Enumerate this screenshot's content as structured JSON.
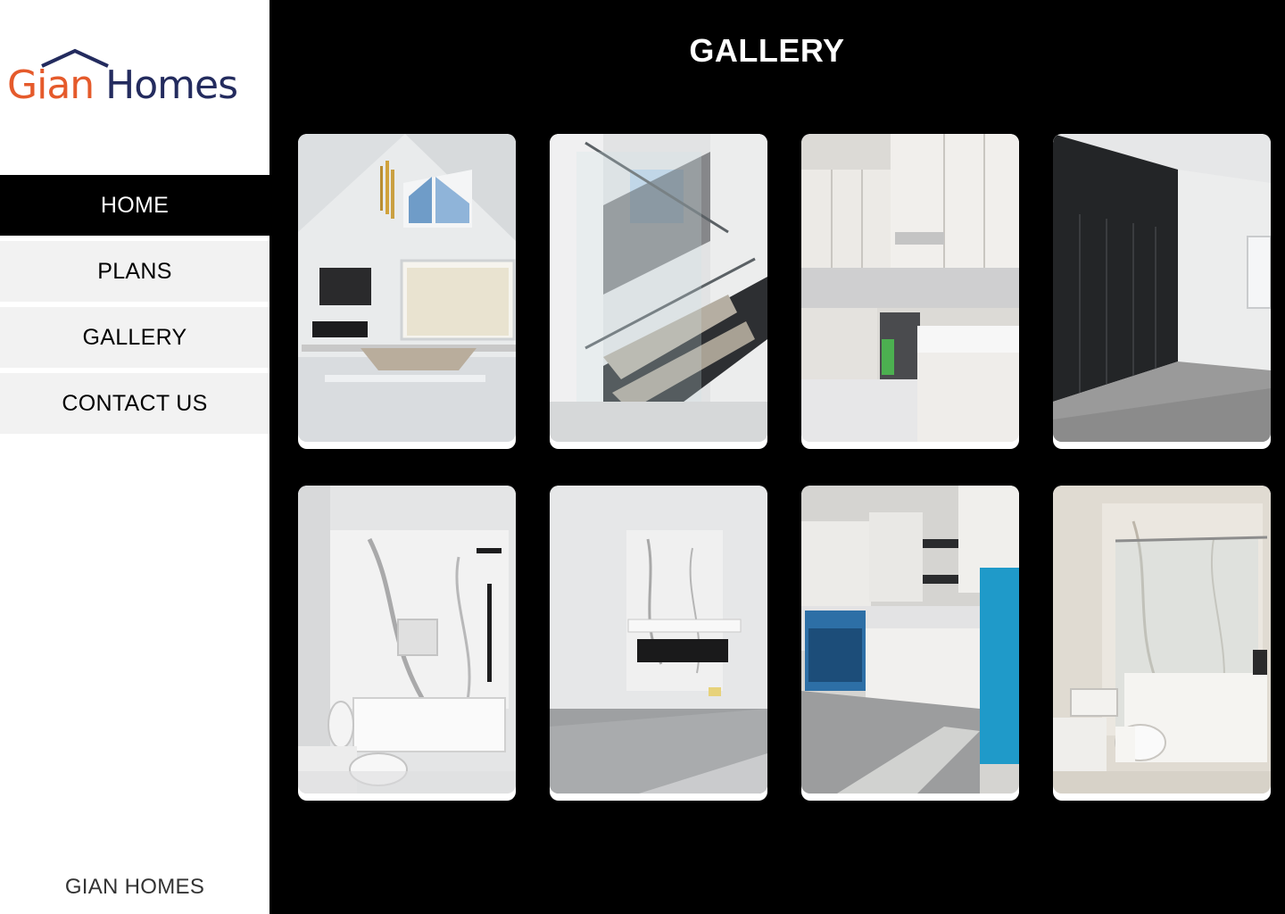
{
  "brand": {
    "logo_part1": "Gian",
    "logo_part2": " Homes",
    "footer": "GIAN HOMES",
    "colors": {
      "orange": "#e55a2b",
      "navy": "#232b5e"
    }
  },
  "nav": {
    "items": [
      {
        "label": "HOME",
        "active": true
      },
      {
        "label": "PLANS",
        "active": false
      },
      {
        "label": "GALLERY",
        "active": false
      },
      {
        "label": "CONTACT US",
        "active": false
      }
    ]
  },
  "main": {
    "title": "GALLERY"
  },
  "gallery": {
    "photos": [
      {
        "subject": "living room with fireplace and tall windows"
      },
      {
        "subject": "glass staircase"
      },
      {
        "subject": "kitchen with white cabinets"
      },
      {
        "subject": "bedroom with dark accent wall"
      },
      {
        "subject": "bathroom with marble shower and tub"
      },
      {
        "subject": "marble fireplace wall"
      },
      {
        "subject": "kitchen with blue refrigerator"
      },
      {
        "subject": "bathroom with glass shower"
      }
    ]
  }
}
